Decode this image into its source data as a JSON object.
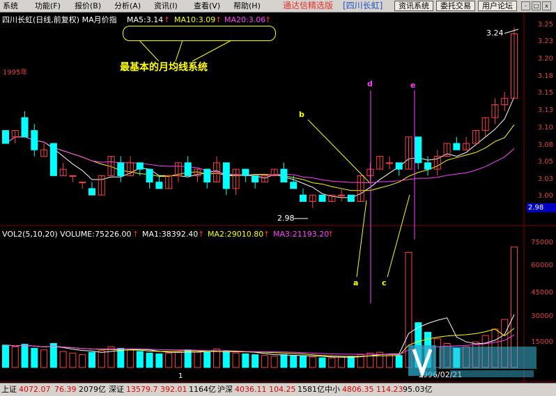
{
  "menubar": {
    "items": [
      "系统",
      "功能(F)",
      "报价(B)",
      "分析(A)",
      "资讯(I)",
      "查看(V)",
      "帮助(H)"
    ],
    "app_title": "通达信精选版",
    "stock_tag": "[四川长虹]",
    "buttons": [
      "资讯系统",
      "委托交易",
      "用户论坛"
    ],
    "window_controls": [
      "-",
      "□",
      "x"
    ]
  },
  "chart": {
    "price_header": "四川长虹(日线,前复权) MA月价指",
    "ma_labels": [
      {
        "text": "MA5:3.14",
        "arrow": "↑",
        "color": "#ffffff"
      },
      {
        "text": "MA10:3.09",
        "arrow": "↑",
        "color": "#ffff00"
      },
      {
        "text": "MA20:3.06",
        "arrow": "↑",
        "color": "#ff40ff"
      }
    ],
    "annotation_title": "最基本的月均线系统",
    "year_label": "1995年",
    "price_axis": [
      "3.25",
      "3.23",
      "3.20",
      "3.18",
      "3.15",
      "3.13",
      "3.10",
      "3.08",
      "3.05",
      "3.03",
      "3.00"
    ],
    "current_price": "2.98",
    "high_marker": "3.24",
    "low_marker": "2.98",
    "point_labels": {
      "a": "a",
      "b": "b",
      "c": "c",
      "d": "d",
      "e": "e"
    },
    "volume_header": {
      "main": "VOL2(5,10,20) VOLUME:75226.00",
      "ma1": "MA1:38392.40",
      "ma2": "MA2:29010.80",
      "ma3": "MA3:21193.20",
      "arrow": "↑"
    },
    "volume_axis": [
      "75000",
      "60000",
      "45000",
      "30000",
      "15000"
    ],
    "volume_marker": "1",
    "date_label": "1996/02/21",
    "colors": {
      "up": "#ff4040",
      "down": "#00ffff",
      "ma5": "#ffffff",
      "ma10": "#ffff00",
      "ma20": "#ff40ff",
      "grid": "#800000"
    }
  },
  "chart_data": {
    "type": "candlestick",
    "title": "四川长虹(日线,前复权)",
    "ylim": [
      2.96,
      3.26
    ],
    "volume_ylim": [
      0,
      80000
    ],
    "candles": [
      {
        "o": 3.09,
        "c": 3.07,
        "h": 3.09,
        "l": 3.07,
        "v": 14000
      },
      {
        "o": 3.08,
        "c": 3.09,
        "h": 3.09,
        "l": 3.07,
        "v": 13000
      },
      {
        "o": 3.11,
        "c": 3.08,
        "h": 3.12,
        "l": 3.08,
        "v": 14500
      },
      {
        "o": 3.09,
        "c": 3.06,
        "h": 3.1,
        "l": 3.05,
        "v": 12000
      },
      {
        "o": 3.05,
        "c": 3.06,
        "h": 3.07,
        "l": 3.05,
        "v": 11000
      },
      {
        "o": 3.07,
        "c": 3.02,
        "h": 3.07,
        "l": 3.02,
        "v": 15000
      },
      {
        "o": 3.02,
        "c": 3.03,
        "h": 3.04,
        "l": 3.02,
        "v": 10000
      },
      {
        "o": 3.02,
        "c": 3.02,
        "h": 3.02,
        "l": 3.01,
        "v": 9000
      },
      {
        "o": 3.01,
        "c": 3.01,
        "h": 3.01,
        "l": 3.0,
        "v": 8000
      },
      {
        "o": 3.0,
        "c": 2.99,
        "h": 3.01,
        "l": 2.99,
        "v": 9500
      },
      {
        "o": 2.99,
        "c": 3.02,
        "h": 3.02,
        "l": 2.99,
        "v": 10500
      },
      {
        "o": 3.02,
        "c": 3.05,
        "h": 3.05,
        "l": 3.02,
        "v": 13000
      },
      {
        "o": 3.04,
        "c": 3.02,
        "h": 3.05,
        "l": 3.01,
        "v": 12000
      },
      {
        "o": 3.02,
        "c": 3.04,
        "h": 3.05,
        "l": 3.02,
        "v": 11000
      },
      {
        "o": 3.04,
        "c": 3.03,
        "h": 3.04,
        "l": 3.02,
        "v": 10000
      },
      {
        "o": 3.03,
        "c": 3.01,
        "h": 3.03,
        "l": 3.0,
        "v": 9000
      },
      {
        "o": 3.01,
        "c": 3.0,
        "h": 3.02,
        "l": 3.0,
        "v": 8500
      },
      {
        "o": 3.0,
        "c": 3.02,
        "h": 3.02,
        "l": 3.0,
        "v": 9000
      },
      {
        "o": 3.02,
        "c": 3.04,
        "h": 3.04,
        "l": 3.01,
        "v": 10000
      },
      {
        "o": 3.04,
        "c": 3.02,
        "h": 3.05,
        "l": 3.02,
        "v": 11000
      },
      {
        "o": 3.02,
        "c": 3.03,
        "h": 3.03,
        "l": 3.01,
        "v": 9500
      },
      {
        "o": 3.03,
        "c": 3.01,
        "h": 3.03,
        "l": 3.0,
        "v": 10000
      },
      {
        "o": 3.01,
        "c": 3.04,
        "h": 3.05,
        "l": 3.01,
        "v": 11500
      },
      {
        "o": 3.04,
        "c": 3.0,
        "h": 3.04,
        "l": 2.99,
        "v": 10500
      },
      {
        "o": 3.0,
        "c": 3.03,
        "h": 3.03,
        "l": 2.99,
        "v": 9000
      },
      {
        "o": 3.03,
        "c": 3.02,
        "h": 3.03,
        "l": 3.01,
        "v": 8500
      },
      {
        "o": 3.02,
        "c": 3.01,
        "h": 3.02,
        "l": 3.0,
        "v": 8000
      },
      {
        "o": 3.01,
        "c": 3.02,
        "h": 3.02,
        "l": 3.01,
        "v": 7500
      },
      {
        "o": 3.02,
        "c": 3.03,
        "h": 3.03,
        "l": 3.02,
        "v": 7000
      },
      {
        "o": 3.03,
        "c": 3.01,
        "h": 3.04,
        "l": 3.01,
        "v": 8000
      },
      {
        "o": 3.01,
        "c": 3.0,
        "h": 3.02,
        "l": 3.0,
        "v": 7500
      },
      {
        "o": 2.99,
        "c": 2.98,
        "h": 3.0,
        "l": 2.98,
        "v": 7000
      },
      {
        "o": 2.98,
        "c": 2.99,
        "h": 2.99,
        "l": 2.97,
        "v": 6500
      },
      {
        "o": 2.99,
        "c": 2.98,
        "h": 2.99,
        "l": 2.98,
        "v": 6000
      },
      {
        "o": 2.98,
        "c": 2.99,
        "h": 2.99,
        "l": 2.98,
        "v": 6000
      },
      {
        "o": 2.99,
        "c": 2.99,
        "h": 3.0,
        "l": 2.98,
        "v": 6500
      },
      {
        "o": 2.99,
        "c": 2.98,
        "h": 2.99,
        "l": 2.98,
        "v": 7000
      },
      {
        "o": 2.98,
        "c": 3.02,
        "h": 3.02,
        "l": 2.98,
        "v": 8000
      },
      {
        "o": 3.02,
        "c": 3.03,
        "h": 3.04,
        "l": 3.01,
        "v": 9000
      },
      {
        "o": 3.03,
        "c": 3.05,
        "h": 3.05,
        "l": 3.03,
        "v": 9500
      },
      {
        "o": 3.04,
        "c": 3.04,
        "h": 3.05,
        "l": 3.03,
        "v": 8000
      },
      {
        "o": 3.04,
        "c": 3.03,
        "h": 3.04,
        "l": 3.02,
        "v": 7500
      },
      {
        "o": 3.03,
        "c": 3.08,
        "h": 3.08,
        "l": 3.03,
        "v": 72000
      },
      {
        "o": 3.08,
        "c": 3.04,
        "h": 3.08,
        "l": 3.03,
        "v": 28000
      },
      {
        "o": 3.04,
        "c": 3.03,
        "h": 3.05,
        "l": 3.02,
        "v": 22000
      },
      {
        "o": 3.03,
        "c": 3.05,
        "h": 3.06,
        "l": 3.02,
        "v": 18000
      },
      {
        "o": 3.05,
        "c": 3.07,
        "h": 3.07,
        "l": 3.05,
        "v": 15000
      },
      {
        "o": 3.07,
        "c": 3.06,
        "h": 3.08,
        "l": 3.06,
        "v": 12000
      },
      {
        "o": 3.06,
        "c": 3.07,
        "h": 3.08,
        "l": 3.06,
        "v": 13000
      },
      {
        "o": 3.07,
        "c": 3.09,
        "h": 3.09,
        "l": 3.07,
        "v": 16000
      },
      {
        "o": 3.09,
        "c": 3.11,
        "h": 3.11,
        "l": 3.08,
        "v": 20000
      },
      {
        "o": 3.11,
        "c": 3.13,
        "h": 3.14,
        "l": 3.1,
        "v": 24000
      },
      {
        "o": 3.13,
        "c": 3.14,
        "h": 3.15,
        "l": 3.12,
        "v": 30000
      },
      {
        "o": 3.14,
        "c": 3.24,
        "h": 3.25,
        "l": 3.14,
        "v": 75226
      }
    ]
  },
  "statusbar": {
    "items": [
      {
        "name": "上证",
        "value": "4072.07",
        "change": "76.39",
        "amount": "2079亿"
      },
      {
        "name": "深证",
        "value": "13579.7",
        "change": "392.01",
        "amount": "1164亿"
      },
      {
        "name": "沪深",
        "value": "4036.11",
        "change": "104.25",
        "amount": "1581亿"
      },
      {
        "name": "中小",
        "value": "4806.35",
        "change": "114.23",
        "amount": "95.03亿"
      }
    ]
  }
}
